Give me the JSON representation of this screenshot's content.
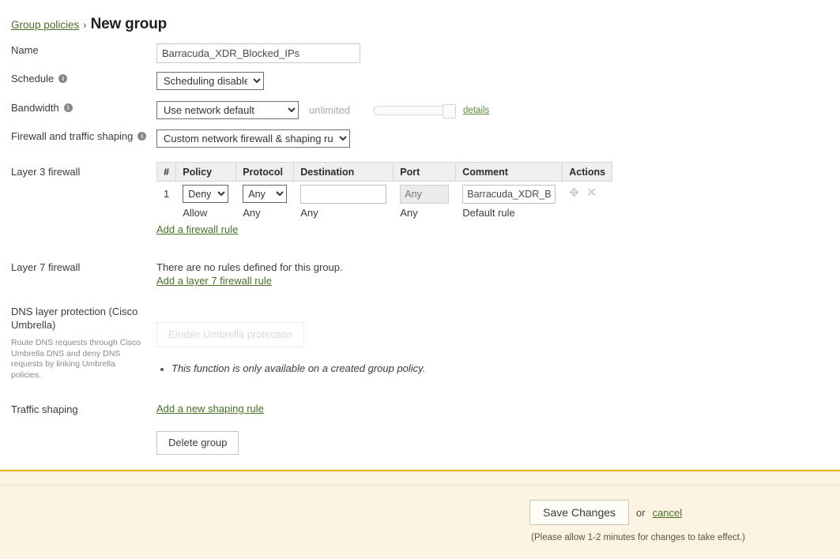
{
  "breadcrumb": {
    "parent_link": "Group policies",
    "separator": "›",
    "current": "New group"
  },
  "form": {
    "name": {
      "label": "Name",
      "value": "Barracuda_XDR_Blocked_IPs"
    },
    "schedule": {
      "label": "Schedule",
      "info_icon": "info-icon",
      "selected": "Scheduling disabled",
      "options": [
        "Scheduling disabled"
      ]
    },
    "bandwidth": {
      "label": "Bandwidth",
      "info_icon": "info-icon",
      "selected": "Use network default",
      "options": [
        "Use network default"
      ],
      "limit_text": "unlimited",
      "details_link": "details"
    },
    "firewall_shaping": {
      "label": "Firewall and traffic shaping",
      "info_icon": "info-icon",
      "selected": "Custom network firewall & shaping rules",
      "options": [
        "Custom network firewall & shaping rules"
      ]
    },
    "layer3": {
      "label": "Layer 3 firewall",
      "columns": [
        "#",
        "Policy",
        "Protocol",
        "Destination",
        "Port",
        "Comment",
        "Actions"
      ],
      "rule": {
        "num": "1",
        "policy_selected": "Deny",
        "policy_options": [
          "Deny",
          "Allow"
        ],
        "protocol_selected": "Any",
        "protocol_options": [
          "Any"
        ],
        "destination_value": "",
        "port_placeholder": "Any",
        "comment_value": "Barracuda_XDR_Blocked_IPs",
        "move_icon": "move-handle-icon",
        "delete_icon": "close-icon"
      },
      "default_row": {
        "policy": "Allow",
        "protocol": "Any",
        "destination": "Any",
        "port": "Any",
        "comment": "Default rule"
      },
      "add_link": "Add a firewall rule"
    },
    "layer7": {
      "label": "Layer 7 firewall",
      "empty_text": "There are no rules defined for this group.",
      "add_link": "Add a layer 7 firewall rule"
    },
    "dns": {
      "label": "DNS layer protection (Cisco Umbrella)",
      "description": "Route DNS requests through Cisco Umbrella DNS and deny DNS requests by linking Umbrella policies.",
      "enable_button": "Enable Umbrella protection",
      "note": "This function is only available on a created group policy."
    },
    "traffic_shaping": {
      "label": "Traffic shaping",
      "add_link": "Add a new shaping rule"
    },
    "delete_button": "Delete group"
  },
  "footer": {
    "save_label": "Save Changes",
    "or_text": "or",
    "cancel_label": "cancel",
    "note": "(Please allow 1-2 minutes for changes to take effect.)"
  },
  "colors": {
    "link_green": "#47702a",
    "footer_bg": "#fdf3e3",
    "footer_border": "#e8b300",
    "table_header_bg": "#efefef"
  }
}
